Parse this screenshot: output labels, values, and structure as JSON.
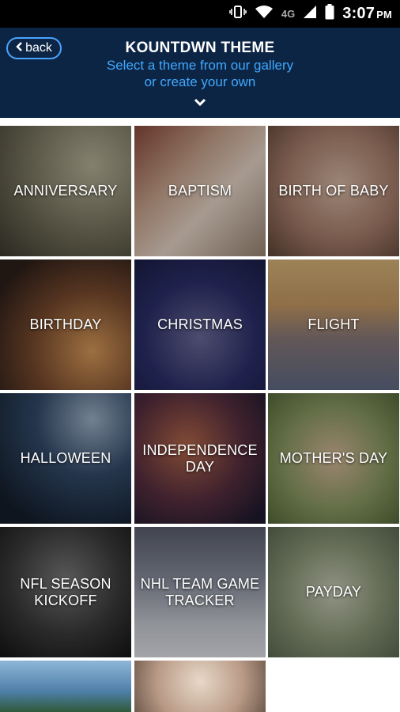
{
  "status_bar": {
    "network": "4G",
    "time": "3:07",
    "ampm": "PM",
    "icons": [
      "vibrate-icon",
      "wifi-icon",
      "signal-icon",
      "battery-icon"
    ]
  },
  "header": {
    "back_label": "back",
    "title": "KOUNTDWN THEME",
    "subtitle_line1": "Select a theme from our gallery",
    "subtitle_line2": "or create your own",
    "colors": {
      "background": "#0d2545",
      "accent": "#3fa9ff"
    }
  },
  "themes": [
    {
      "label": "ANNIVERSARY"
    },
    {
      "label": "BAPTISM"
    },
    {
      "label": "BIRTH OF BABY"
    },
    {
      "label": "BIRTHDAY"
    },
    {
      "label": "CHRISTMAS"
    },
    {
      "label": "FLIGHT"
    },
    {
      "label": "HALLOWEEN"
    },
    {
      "label": "INDEPENDENCE DAY"
    },
    {
      "label": "MOTHER'S DAY"
    },
    {
      "label": "NFL SEASON KICKOFF"
    },
    {
      "label": "NHL TEAM GAME TRACKER"
    },
    {
      "label": "PAYDAY"
    },
    {
      "label": ""
    },
    {
      "label": ""
    }
  ]
}
